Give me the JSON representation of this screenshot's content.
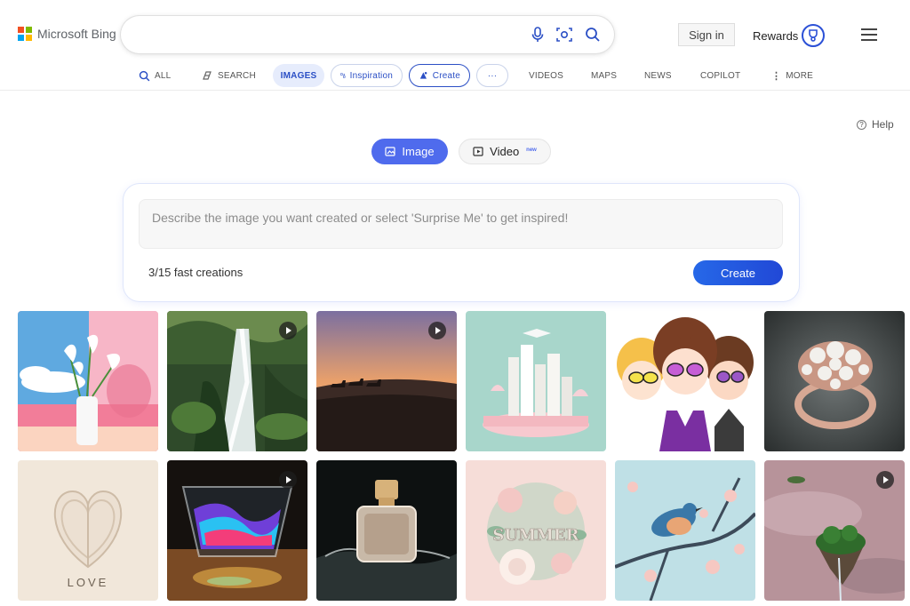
{
  "brand": {
    "logo_text": "Microsoft Bing"
  },
  "search": {
    "value": "",
    "placeholder": ""
  },
  "header": {
    "signin_label": "Sign in",
    "rewards_label": "Rewards"
  },
  "nav": {
    "all": "ALL",
    "search": "SEARCH",
    "images": "IMAGES",
    "inspiration": "Inspiration",
    "create": "Create",
    "more_dots": "···",
    "videos": "VIDEOS",
    "maps": "MAPS",
    "news": "NEWS",
    "copilot": "COPILOT",
    "more": "MORE"
  },
  "help": {
    "label": "Help",
    "icon": "?"
  },
  "mode_toggle": {
    "image_label": "Image",
    "video_label": "Video",
    "new_tag": "new"
  },
  "prompt": {
    "placeholder": "Describe the image you want created or select 'Surprise Me' to get inspired!",
    "value": "",
    "fast_creations": "3/15 fast creations",
    "create_label": "Create"
  },
  "gallery": {
    "love_text": "LOVE",
    "summer_text": "SUMMER"
  },
  "colors": {
    "accent": "#4f6bed",
    "link": "#2b4fc5"
  }
}
